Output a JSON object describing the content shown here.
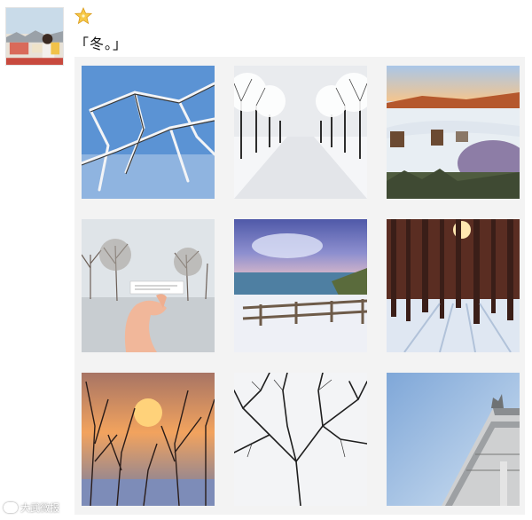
{
  "post": {
    "emoji": "star-emoji",
    "text": "「冬。」"
  },
  "images": [
    {
      "name": "photo-snowy-branches-blue-sky"
    },
    {
      "name": "photo-snow-tree-avenue"
    },
    {
      "name": "photo-snowy-lawn-chairs-sunset"
    },
    {
      "name": "photo-hand-holding-note-snowy-park"
    },
    {
      "name": "photo-snowy-boardwalk-sea"
    },
    {
      "name": "photo-pine-forest-sunlight"
    },
    {
      "name": "photo-sunset-through-branches"
    },
    {
      "name": "photo-bare-branches-snow"
    },
    {
      "name": "photo-building-roof-sky"
    }
  ],
  "watermark": {
    "text": "大武微报"
  },
  "colors": {
    "sky_blue": "#5b93d4",
    "snow": "#f2f4f7",
    "sunset": "#f2a35e"
  }
}
